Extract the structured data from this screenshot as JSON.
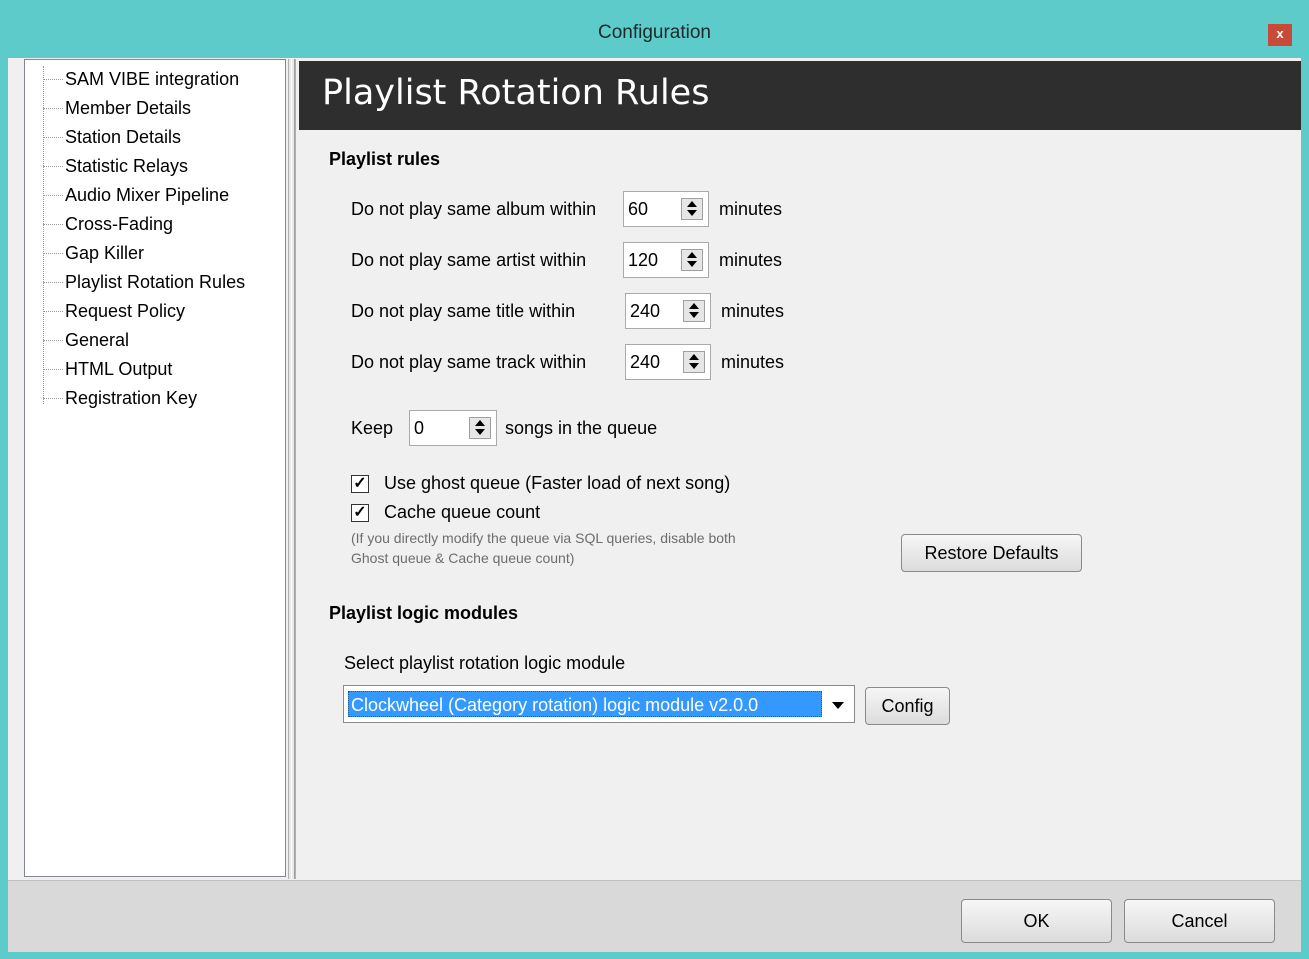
{
  "window": {
    "title": "Configuration",
    "close_label": "x"
  },
  "sidebar": {
    "items": [
      {
        "label": "SAM VIBE integration"
      },
      {
        "label": "Member Details"
      },
      {
        "label": "Station Details"
      },
      {
        "label": "Statistic Relays"
      },
      {
        "label": "Audio Mixer Pipeline"
      },
      {
        "label": "Cross-Fading"
      },
      {
        "label": "Gap Killer"
      },
      {
        "label": "Playlist Rotation Rules"
      },
      {
        "label": "Request Policy"
      },
      {
        "label": "General"
      },
      {
        "label": "HTML Output"
      },
      {
        "label": "Registration Key"
      }
    ]
  },
  "page": {
    "header": "Playlist Rotation Rules"
  },
  "rules": {
    "section_title": "Playlist rules",
    "album": {
      "label": "Do not play same album within",
      "value": "60",
      "unit": "minutes"
    },
    "artist": {
      "label": "Do not play same artist within",
      "value": "120",
      "unit": "minutes"
    },
    "title": {
      "label": "Do not play same title within",
      "value": "240",
      "unit": "minutes"
    },
    "track": {
      "label": "Do not play same track within",
      "value": "240",
      "unit": "minutes"
    },
    "keep": {
      "prefix": "Keep",
      "value": "0",
      "suffix": "songs in the queue"
    },
    "ghost_queue": {
      "label": "Use ghost queue (Faster load of next song)",
      "checked": true
    },
    "cache_count": {
      "label": "Cache queue count",
      "checked": true
    },
    "note_line1": "(If you directly modify the queue via SQL queries, disable both",
    "note_line2": "Ghost queue & Cache queue count)",
    "restore_label": "Restore Defaults"
  },
  "logic": {
    "section_title": "Playlist logic modules",
    "select_label": "Select playlist rotation logic module",
    "selected": "Clockwheel (Category rotation) logic module v2.0.0",
    "config_label": "Config"
  },
  "footer": {
    "ok_label": "OK",
    "cancel_label": "Cancel"
  },
  "colors": {
    "frame": "#5ecbcb",
    "header_bg": "#2e2e2e",
    "selection": "#3399ff",
    "close": "#c84a3a"
  }
}
